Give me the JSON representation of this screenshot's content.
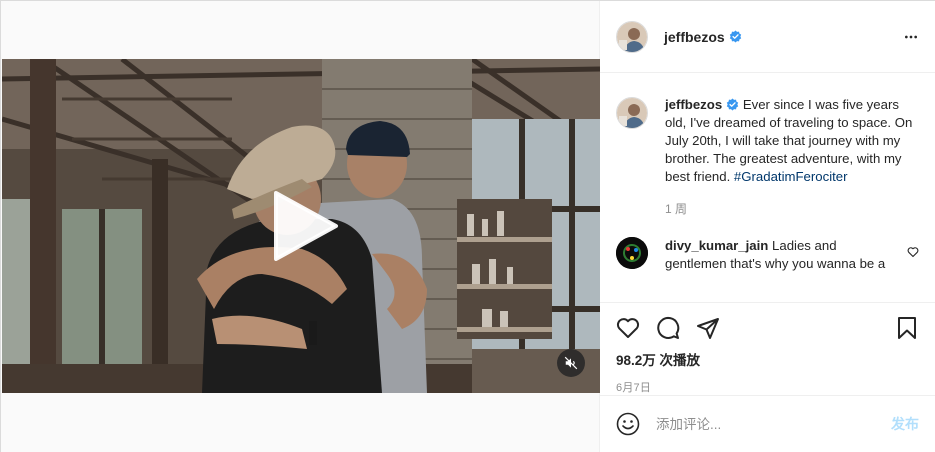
{
  "colors": {
    "verified_blue": "#3897f0",
    "hashtag": "#00376b",
    "post_disabled": "#b2dffc",
    "muted_text": "#8e8e8e"
  },
  "header": {
    "username": "jeffbezos",
    "verified_icon": "verified-badge-icon",
    "more_icon": "more-horizontal-icon"
  },
  "media": {
    "play_icon": "play-icon",
    "mute_icon": "muted-speaker-icon"
  },
  "caption": {
    "username": "jeffbezos",
    "text": "Ever since I was five years old, I've dreamed of traveling to space. On July 20th, I will take that journey with my brother. The greatest adventure, with my best friend.",
    "hashtag": "#GradatimFerociter",
    "time": "1 周"
  },
  "comments": [
    {
      "username": "divy_kumar_jain",
      "text": "Ladies and gentlemen that's why you wanna be a billionaire!!!!"
    }
  ],
  "actions": {
    "like_icon": "heart-icon",
    "comment_icon": "comment-icon",
    "share_icon": "share-icon",
    "save_icon": "bookmark-icon",
    "views": "98.2万 次播放",
    "date": "6月7日"
  },
  "add_comment": {
    "emoji_icon": "emoji-icon",
    "placeholder": "添加评论...",
    "post_label": "发布"
  }
}
